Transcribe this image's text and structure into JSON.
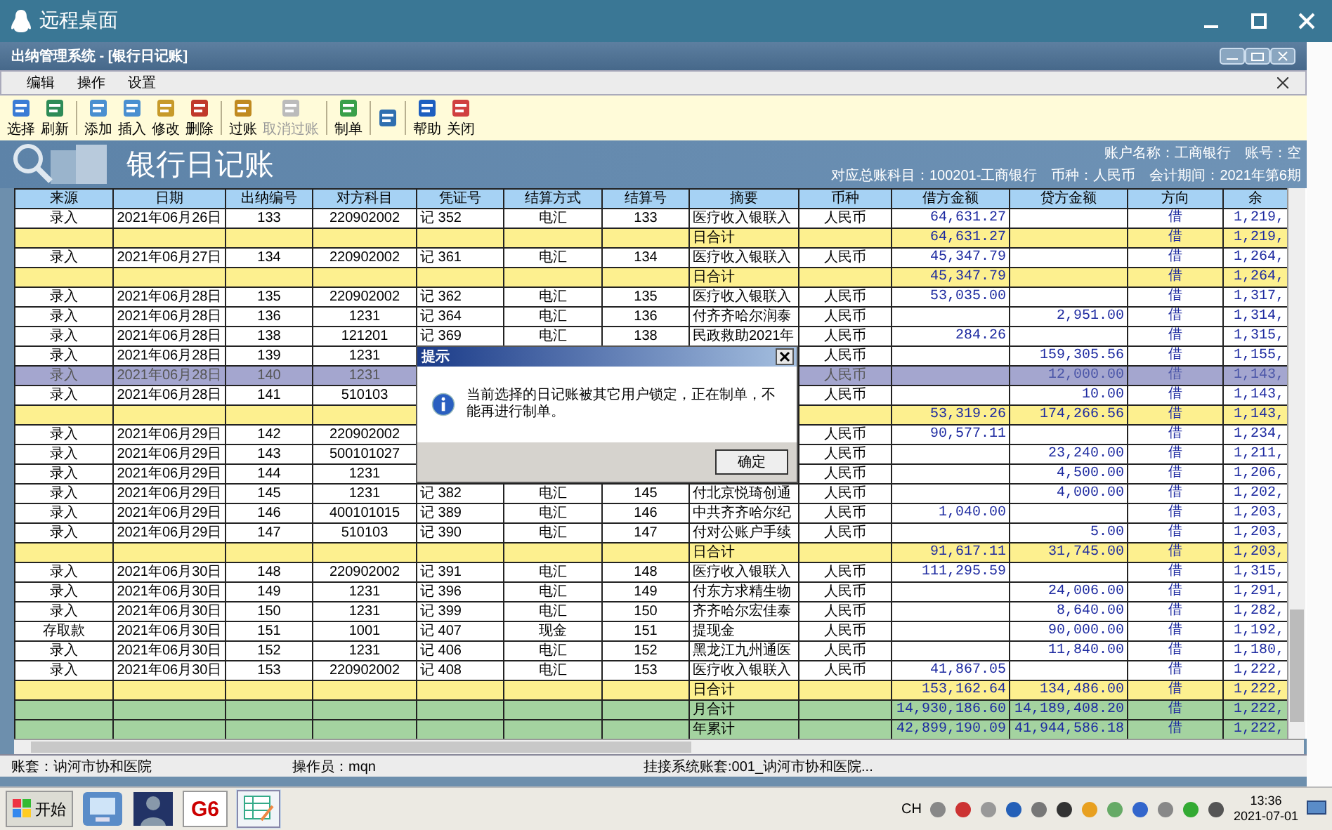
{
  "window": {
    "title": "远程桌面"
  },
  "app": {
    "title": "出纳管理系统 - [银行日记账]"
  },
  "menu": [
    "编辑",
    "操作",
    "设置"
  ],
  "toolbar": [
    [
      {
        "label": "选择",
        "disabled": false
      },
      {
        "label": "刷新",
        "disabled": false
      }
    ],
    [
      {
        "label": "添加",
        "disabled": false
      },
      {
        "label": "插入",
        "disabled": false
      },
      {
        "label": "修改",
        "disabled": false
      },
      {
        "label": "删除",
        "disabled": false
      }
    ],
    [
      {
        "label": "过账",
        "disabled": false
      },
      {
        "label": "取消过账",
        "disabled": true
      }
    ],
    [
      {
        "label": "制单",
        "disabled": false
      }
    ],
    [
      {
        "disabled": false
      }
    ],
    [
      {
        "label": "帮助",
        "disabled": false
      },
      {
        "label": "关闭",
        "disabled": false
      }
    ]
  ],
  "banner": {
    "title": "银行日记账",
    "lines": [
      [
        "账户名称：工商银行",
        "账号：空"
      ],
      [
        "对应总账科目：100201-工商银行",
        "币种：人民币",
        "会计期间：2021年第6期"
      ]
    ]
  },
  "table": {
    "columns": [
      "来源",
      "日期",
      "出纳编号",
      "对方科目",
      "凭证号",
      "结算方式",
      "结算号",
      "摘要",
      "币种",
      "借方金额",
      "贷方金额",
      "方向",
      "余"
    ],
    "rows": [
      {
        "kind": "entry",
        "selected": false,
        "cells": [
          "录入",
          "2021年06月26日",
          "133",
          "220902002",
          "记 352",
          "电汇",
          "133",
          "医疗收入银联入",
          "人民币",
          "64,631.27",
          null,
          "借",
          "1,219,"
        ]
      },
      {
        "kind": "day_total",
        "selected": false,
        "cells": [
          null,
          null,
          null,
          null,
          null,
          null,
          null,
          "日合计",
          null,
          "64,631.27",
          null,
          "借",
          "1,219,"
        ]
      },
      {
        "kind": "entry",
        "selected": false,
        "cells": [
          "录入",
          "2021年06月27日",
          "134",
          "220902002",
          "记 361",
          "电汇",
          "134",
          "医疗收入银联入",
          "人民币",
          "45,347.79",
          null,
          "借",
          "1,264,"
        ]
      },
      {
        "kind": "day_total",
        "selected": false,
        "cells": [
          null,
          null,
          null,
          null,
          null,
          null,
          null,
          "日合计",
          null,
          "45,347.79",
          null,
          "借",
          "1,264,"
        ]
      },
      {
        "kind": "entry",
        "selected": false,
        "cells": [
          "录入",
          "2021年06月28日",
          "135",
          "220902002",
          "记 362",
          "电汇",
          "135",
          "医疗收入银联入",
          "人民币",
          "53,035.00",
          null,
          "借",
          "1,317,"
        ]
      },
      {
        "kind": "entry",
        "selected": false,
        "cells": [
          "录入",
          "2021年06月28日",
          "136",
          "1231",
          "记 364",
          "电汇",
          "136",
          "付齐齐哈尔润泰",
          "人民币",
          null,
          "2,951.00",
          "借",
          "1,314,"
        ]
      },
      {
        "kind": "entry",
        "selected": false,
        "cells": [
          "录入",
          "2021年06月28日",
          "138",
          "121201",
          "记 369",
          "电汇",
          "138",
          "民政救助2021年",
          "人民币",
          "284.26",
          null,
          "借",
          "1,315,"
        ]
      },
      {
        "kind": "entry",
        "selected": false,
        "cells": [
          "录入",
          "2021年06月28日",
          "139",
          "1231",
          null,
          null,
          null,
          null,
          "人民币",
          null,
          "159,305.56",
          "借",
          "1,155,"
        ]
      },
      {
        "kind": "entry",
        "selected": true,
        "cells": [
          "录入",
          "2021年06月28日",
          "140",
          "1231",
          null,
          null,
          null,
          null,
          "人民币",
          null,
          "12,000.00",
          "借",
          "1,143,"
        ]
      },
      {
        "kind": "entry",
        "selected": false,
        "cells": [
          "录入",
          "2021年06月28日",
          "141",
          "510103",
          null,
          null,
          null,
          null,
          "人民币",
          null,
          "10.00",
          "借",
          "1,143,"
        ]
      },
      {
        "kind": "day_total",
        "selected": false,
        "cells": [
          null,
          null,
          null,
          null,
          null,
          null,
          null,
          null,
          null,
          "53,319.26",
          "174,266.56",
          "借",
          "1,143,"
        ]
      },
      {
        "kind": "entry",
        "selected": false,
        "cells": [
          "录入",
          "2021年06月29日",
          "142",
          "220902002",
          null,
          null,
          null,
          null,
          "人民币",
          "90,577.11",
          null,
          "借",
          "1,234,"
        ]
      },
      {
        "kind": "entry",
        "selected": false,
        "cells": [
          "录入",
          "2021年06月29日",
          "143",
          "500101027",
          null,
          null,
          null,
          null,
          "人民币",
          null,
          "23,240.00",
          "借",
          "1,211,"
        ]
      },
      {
        "kind": "entry",
        "selected": false,
        "cells": [
          "录入",
          "2021年06月29日",
          "144",
          "1231",
          null,
          null,
          null,
          null,
          "人民币",
          null,
          "4,500.00",
          "借",
          "1,206,"
        ]
      },
      {
        "kind": "entry",
        "selected": false,
        "cells": [
          "录入",
          "2021年06月29日",
          "145",
          "1231",
          "记 382",
          "电汇",
          "145",
          "付北京悦琦创通",
          "人民币",
          null,
          "4,000.00",
          "借",
          "1,202,"
        ]
      },
      {
        "kind": "entry",
        "selected": false,
        "cells": [
          "录入",
          "2021年06月29日",
          "146",
          "400101015",
          "记 389",
          "电汇",
          "146",
          "中共齐齐哈尔纪",
          "人民币",
          "1,040.00",
          null,
          "借",
          "1,203,"
        ]
      },
      {
        "kind": "entry",
        "selected": false,
        "cells": [
          "录入",
          "2021年06月29日",
          "147",
          "510103",
          "记 390",
          "电汇",
          "147",
          "付对公账户手续",
          "人民币",
          null,
          "5.00",
          "借",
          "1,203,"
        ]
      },
      {
        "kind": "day_total",
        "selected": false,
        "cells": [
          null,
          null,
          null,
          null,
          null,
          null,
          null,
          "日合计",
          null,
          "91,617.11",
          "31,745.00",
          "借",
          "1,203,"
        ]
      },
      {
        "kind": "entry",
        "selected": false,
        "cells": [
          "录入",
          "2021年06月30日",
          "148",
          "220902002",
          "记 391",
          "电汇",
          "148",
          "医疗收入银联入",
          "人民币",
          "111,295.59",
          null,
          "借",
          "1,315,"
        ]
      },
      {
        "kind": "entry",
        "selected": false,
        "cells": [
          "录入",
          "2021年06月30日",
          "149",
          "1231",
          "记 396",
          "电汇",
          "149",
          "付东方求精生物",
          "人民币",
          null,
          "24,006.00",
          "借",
          "1,291,"
        ]
      },
      {
        "kind": "entry",
        "selected": false,
        "cells": [
          "录入",
          "2021年06月30日",
          "150",
          "1231",
          "记 399",
          "电汇",
          "150",
          "齐齐哈尔宏佳泰",
          "人民币",
          null,
          "8,640.00",
          "借",
          "1,282,"
        ]
      },
      {
        "kind": "entry",
        "selected": false,
        "cells": [
          "存取款",
          "2021年06月30日",
          "151",
          "1001",
          "记 407",
          "现金",
          "151",
          "提现金",
          "人民币",
          null,
          "90,000.00",
          "借",
          "1,192,"
        ]
      },
      {
        "kind": "entry",
        "selected": false,
        "cells": [
          "录入",
          "2021年06月30日",
          "152",
          "1231",
          "记 406",
          "电汇",
          "152",
          "黑龙江九州通医",
          "人民币",
          null,
          "11,840.00",
          "借",
          "1,180,"
        ]
      },
      {
        "kind": "entry",
        "selected": false,
        "cells": [
          "录入",
          "2021年06月30日",
          "153",
          "220902002",
          "记 408",
          "电汇",
          "153",
          "医疗收入银联入",
          "人民币",
          "41,867.05",
          null,
          "借",
          "1,222,"
        ]
      },
      {
        "kind": "day_total",
        "selected": false,
        "cells": [
          null,
          null,
          null,
          null,
          null,
          null,
          null,
          "日合计",
          null,
          "153,162.64",
          "134,486.00",
          "借",
          "1,222,"
        ]
      },
      {
        "kind": "period_total",
        "selected": false,
        "cells": [
          null,
          null,
          null,
          null,
          null,
          null,
          null,
          "月合计",
          null,
          "14,930,186.60",
          "14,189,408.20",
          "借",
          "1,222,"
        ]
      },
      {
        "kind": "period_total",
        "selected": false,
        "cells": [
          null,
          null,
          null,
          null,
          null,
          null,
          null,
          "年累计",
          null,
          "42,899,190.09",
          "41,944,586.18",
          "借",
          "1,222,"
        ]
      }
    ]
  },
  "dialog": {
    "title": "提示",
    "message": "当前选择的日记账被其它用户锁定，正在制单，不能再进行制单。",
    "button": "确定"
  },
  "status_bar": [
    "账套：讷河市协和医院",
    "操作员：mqn",
    "挂接系统账套:001_讷河市协和医院..."
  ],
  "taskbar": {
    "start": "开始",
    "app_label": "G6",
    "language": "CH",
    "time": "13:36",
    "date": "2021-07-01"
  }
}
